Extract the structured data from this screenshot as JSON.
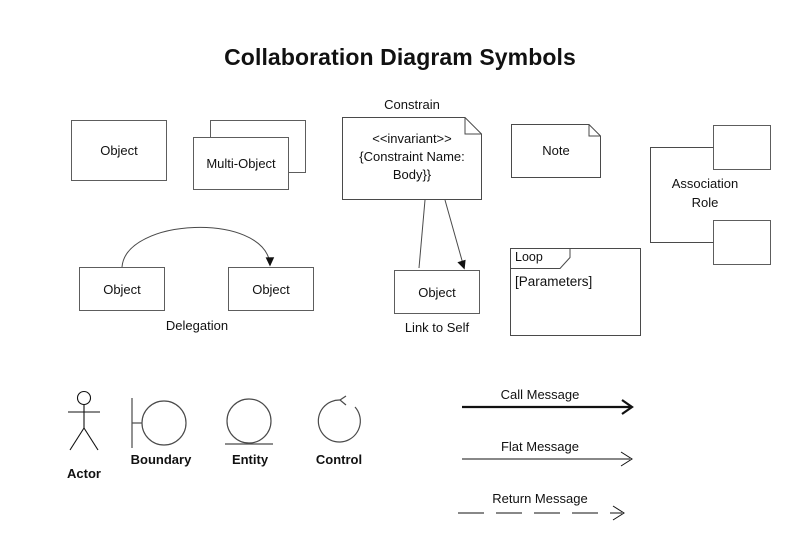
{
  "title": "Collaboration Diagram Symbols",
  "symbols": {
    "object": {
      "label": "Object"
    },
    "multi_object": {
      "label": "Multi-Object"
    },
    "constrain": {
      "caption": "Constrain",
      "line1": "<<invariant>>",
      "line2": "{Constraint Name:",
      "line3": "Body}}"
    },
    "note": {
      "label": "Note"
    },
    "association_role": {
      "line1": "Association",
      "line2": "Role"
    },
    "delegation": {
      "caption": "Delegation",
      "source_label": "Object",
      "target_label": "Object"
    },
    "link_to_self": {
      "caption": "Link to Self",
      "object_label": "Object"
    },
    "loop": {
      "frame_label": "Loop",
      "parameters": "[Parameters]"
    }
  },
  "stereotypes": [
    {
      "name": "Actor",
      "icon": "actor-stick-figure-icon"
    },
    {
      "name": "Boundary",
      "icon": "boundary-circle-icon"
    },
    {
      "name": "Entity",
      "icon": "entity-circle-icon"
    },
    {
      "name": "Control",
      "icon": "control-circle-arrow-icon"
    }
  ],
  "messages": [
    {
      "label": "Call Message",
      "style": "solid-thick"
    },
    {
      "label": "Flat Message",
      "style": "solid-thin"
    },
    {
      "label": "Return Message",
      "style": "dashed"
    }
  ],
  "colors": {
    "background": "#ffffff",
    "line": "#4a4a4a",
    "text": "#111111",
    "accent_line": "#111111"
  }
}
